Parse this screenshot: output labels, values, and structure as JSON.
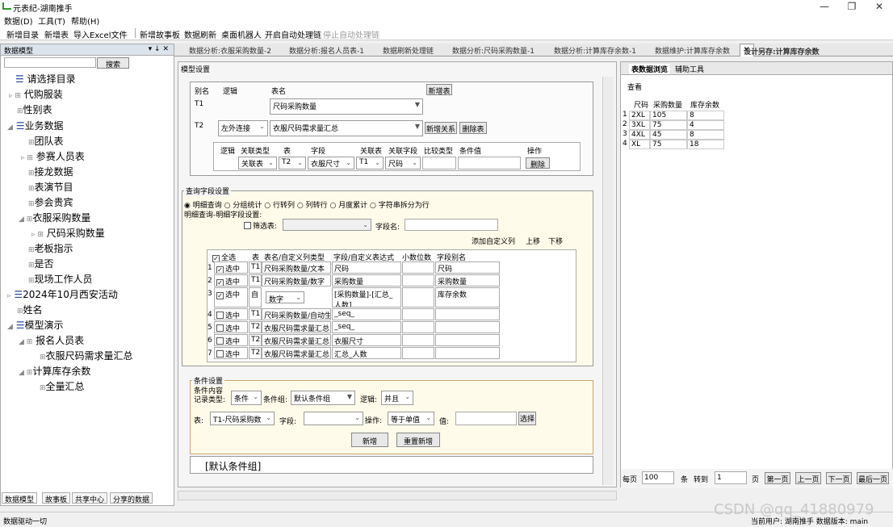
{
  "window": {
    "title": "元表纪-湖南推手",
    "min": "—",
    "max": "❐",
    "close": "✕"
  },
  "menu": [
    "数据(D)",
    "工具(T)",
    "帮助(H)"
  ],
  "toolbar": [
    "新增目录",
    "新增表",
    "导入Excel文件",
    "新增故事板",
    "数据刷新",
    "桌面机器人",
    "开启自动处理链",
    "停止自动处理链"
  ],
  "left": {
    "title": "数据模型",
    "pin": "▾ ↓ ✕",
    "search_button": "搜索",
    "tree": [
      {
        "label": "请选择目录",
        "type": "list"
      },
      {
        "label": "代购服装",
        "type": "table"
      },
      {
        "label": "性别表",
        "type": "table"
      },
      {
        "label": "业务数据",
        "type": "list"
      },
      {
        "label": "团队表",
        "type": "table"
      },
      {
        "label": "参赛人员表",
        "type": "table"
      },
      {
        "label": "接龙数据",
        "type": "table"
      },
      {
        "label": "表演节目",
        "type": "table"
      },
      {
        "label": "参会贵宾",
        "type": "table"
      },
      {
        "label": "衣服采购数量",
        "type": "table"
      },
      {
        "label": "尺码采购数量",
        "type": "table"
      },
      {
        "label": "老板指示",
        "type": "table"
      },
      {
        "label": "是否",
        "type": "table"
      },
      {
        "label": "现场工作人员",
        "type": "table"
      },
      {
        "label": "2024年10月西安活动",
        "type": "list"
      },
      {
        "label": "姓名",
        "type": "table"
      },
      {
        "label": "模型演示",
        "type": "list"
      },
      {
        "label": "报名人员表",
        "type": "table"
      },
      {
        "label": "衣服尺码需求量汇总",
        "type": "table"
      },
      {
        "label": "计算库存余数",
        "type": "table"
      },
      {
        "label": "全量汇总",
        "type": "table"
      }
    ],
    "bottom_tabs": [
      "数据模型",
      "故事板",
      "共享中心",
      "分享的数据"
    ]
  },
  "doc_tabs": [
    "数据分析:衣服采购数量-2",
    "数据分析:报名人员表-1",
    "数据刷新处理链",
    "数据分析:尺码采购数量-1",
    "数据分析:计算库存余数-1",
    "数据维护:计算库存余数",
    "设计另存:计算库存余数"
  ],
  "model": {
    "title": "模型设置",
    "head": {
      "alias": "别名",
      "logic": "逻辑",
      "table": "表名",
      "add_table": "新增表"
    },
    "t1": {
      "alias": "T1",
      "table": "尺码采购数量"
    },
    "t2": {
      "alias": "T2",
      "logic": "左外连接",
      "table": "衣服尺码需求量汇总",
      "add_rel": "新增关系",
      "del_table": "删除表"
    },
    "rel_head": [
      "逻辑",
      "关联类型",
      "表",
      "字段",
      "关联表",
      "关联字段",
      "比较类型",
      "条件值",
      "操作"
    ],
    "rel_row": {
      "type": "关联表",
      "table": "T2",
      "field": "衣服尺寸",
      "rtable": "T1",
      "rfield": "尺码",
      "op": "删除"
    }
  },
  "query": {
    "title": "查询字段设置",
    "modes": [
      "明细查询",
      "分组统计",
      "行转列",
      "列转行",
      "月度累计",
      "字符串拆分为行"
    ],
    "sub": "明细查询-明细字段设置:",
    "filter": "筛选表:",
    "field_name": "字段名:",
    "actions": [
      "添加自定义列",
      "上移",
      "下移"
    ],
    "cols": [
      "全选",
      "表",
      "表名/自定义列类型",
      "字段/自定义表达式",
      "小数位数",
      "字段别名"
    ],
    "rows": [
      {
        "n": "1",
        "chk": true,
        "sel": "选中",
        "t": "T1",
        "type": "尺码采购数量/文本",
        "expr": "尺码",
        "dec": "",
        "alias": "尺码"
      },
      {
        "n": "2",
        "chk": true,
        "sel": "选中",
        "t": "T1",
        "type": "尺码采购数量/数字",
        "expr": "采购数量",
        "dec": "",
        "alias": "采购数量"
      },
      {
        "n": "3",
        "chk": true,
        "sel": "选中",
        "t": "自",
        "type": "数字",
        "expr": "[采购数量]-[汇总_人数]",
        "dec": "",
        "alias": "库存余数"
      },
      {
        "n": "4",
        "chk": false,
        "sel": "选中",
        "t": "T1",
        "type": "尺码采购数量/自动生",
        "expr": "_seq_",
        "dec": "",
        "alias": ""
      },
      {
        "n": "5",
        "chk": false,
        "sel": "选中",
        "t": "T2",
        "type": "衣服尺码需求量汇总",
        "expr": "_seq_",
        "dec": "",
        "alias": ""
      },
      {
        "n": "6",
        "chk": false,
        "sel": "选中",
        "t": "T2",
        "type": "衣服尺码需求量汇总",
        "expr": "衣服尺寸",
        "dec": "",
        "alias": ""
      },
      {
        "n": "7",
        "chk": false,
        "sel": "选中",
        "t": "T2",
        "type": "衣服尺码需求量汇总",
        "expr": "汇总_人数",
        "dec": "",
        "alias": ""
      }
    ]
  },
  "cond": {
    "title": "条件设置",
    "content": "条件内容",
    "rec_type_label": "记录类型:",
    "rec_type": "条件",
    "group_label": "条件组:",
    "group": "默认条件组",
    "logic_label": "逻辑:",
    "logic": "并且",
    "table_label": "表:",
    "table": "T1-尺码采购数",
    "field_label": "字段:",
    "op_label": "操作:",
    "op": "等于单值",
    "value_label": "值:",
    "choose": "选择",
    "add": "新增",
    "reset": "重置新增",
    "summary": "[默认条件组]"
  },
  "right": {
    "tabs": [
      "表数据浏览",
      "辅助工具"
    ],
    "query": "查看",
    "cols": [
      "尺码",
      "采购数量",
      "库存余数"
    ],
    "rows": [
      [
        "1",
        "2XL",
        "105",
        "8"
      ],
      [
        "2",
        "3XL",
        "75",
        "4"
      ],
      [
        "3",
        "4XL",
        "45",
        "8"
      ],
      [
        "4",
        "XL",
        "75",
        "18"
      ]
    ],
    "pager": {
      "per": "每页",
      "per_val": "100",
      "unit": "条",
      "goto": "转到",
      "page_val": "1",
      "page": "页",
      "first": "第一页",
      "prev": "上一页",
      "next": "下一页",
      "last": "最后一页"
    }
  },
  "status": {
    "left": "数据驱动一切",
    "right": "当前用户: 湖南推手 数据版本: main",
    "watermark": "CSDN @qq_41880979"
  }
}
